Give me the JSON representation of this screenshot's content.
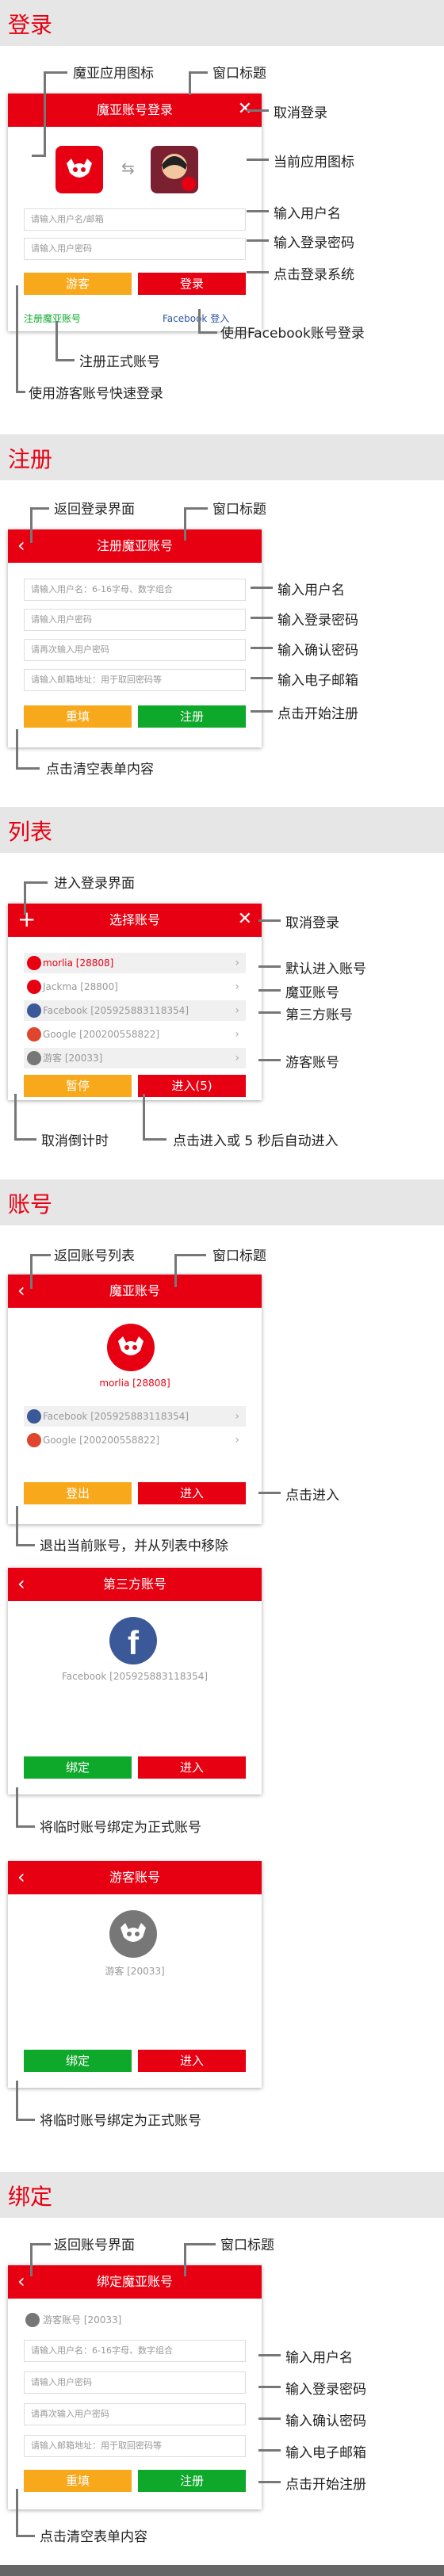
{
  "sections": {
    "login": "登录",
    "register": "注册",
    "list": "列表",
    "account": "账号",
    "bind": "绑定"
  },
  "login": {
    "title": "魔亚账号登录",
    "user_ph": "请输入用户名/邮箱",
    "pwd_ph": "请输入用户密码",
    "guest": "游客",
    "login": "登录",
    "reg": "注册魔亚账号",
    "fb": "Facebook 登入",
    "a_app_icon": "魔亚应用图标",
    "a_title": "窗口标题",
    "a_cancel": "取消登录",
    "a_cur_icon": "当前应用图标",
    "a_user": "输入用户名",
    "a_pwd": "输入登录密码",
    "a_login": "点击登录系统",
    "a_fb": "使用Facebook账号登录",
    "a_reg": "注册正式账号",
    "a_guest": "使用游客账号快速登录"
  },
  "register": {
    "title": "注册魔亚账号",
    "user_ph": "请输入用户名：6-16字母、数字组合",
    "pwd_ph": "请输入用户密码",
    "pwd2_ph": "请再次输入用户密码",
    "email_ph": "请输入邮箱地址：用于取回密码等",
    "reset": "重填",
    "submit": "注册",
    "a_back": "返回登录界面",
    "a_title": "窗口标题",
    "a_user": "输入用户名",
    "a_pwd": "输入登录密码",
    "a_pwd2": "输入确认密码",
    "a_email": "输入电子邮箱",
    "a_submit": "点击开始注册",
    "a_reset": "点击清空表单内容"
  },
  "list": {
    "title": "选择账号",
    "rows": [
      "morlia [28808]",
      "Jackma [28800]",
      "Facebook [205925883118354]",
      "Google [200200558822]",
      "游客 [20033]"
    ],
    "pause": "暂停",
    "enter": "进入(5)",
    "a_enter_login": "进入登录界面",
    "a_cancel": "取消登录",
    "a_default": "默认进入账号",
    "a_moya": "魔亚账号",
    "a_third": "第三方账号",
    "a_guest": "游客账号",
    "a_cancel_count": "取消倒计时",
    "a_auto": "点击进入或 5 秒后自动进入"
  },
  "account": {
    "title": "魔亚账号",
    "name": "morlia [28808]",
    "fb": "Facebook [205925883118354]",
    "google": "Google [200200558822]",
    "logout": "登出",
    "enter": "进入",
    "a_back": "返回账号列表",
    "a_title": "窗口标题",
    "a_enter": "点击进入",
    "a_logout": "退出当前账号，并从列表中移除",
    "third_title": "第三方账号",
    "third_name": "Facebook [205925883118354]",
    "bind": "绑定",
    "enter2": "进入",
    "a_bind": "将临时账号绑定为正式账号",
    "guest_title": "游客账号",
    "guest_name": "游客 [20033]",
    "bind2": "绑定",
    "enter3": "进入",
    "a_bind2": "将临时账号绑定为正式账号"
  },
  "bind": {
    "title": "绑定魔亚账号",
    "guest": "游客账号 [20033]",
    "user_ph": "请输入用户名：6-16字母、数字组合",
    "pwd_ph": "请输入用户密码",
    "pwd2_ph": "请再次输入用户密码",
    "email_ph": "请输入邮箱地址：用于取回密码等",
    "reset": "重填",
    "submit": "注册",
    "a_back": "返回账号界面",
    "a_title": "窗口标题",
    "a_user": "输入用户名",
    "a_pwd": "输入登录密码",
    "a_pwd2": "输入确认密码",
    "a_email": "输入电子邮箱",
    "a_submit": "点击开始注册",
    "a_reset": "点击清空表单内容"
  },
  "colors": {
    "accent": "#e60012",
    "orange": "#f7a81b",
    "green": "#0ea82b"
  }
}
